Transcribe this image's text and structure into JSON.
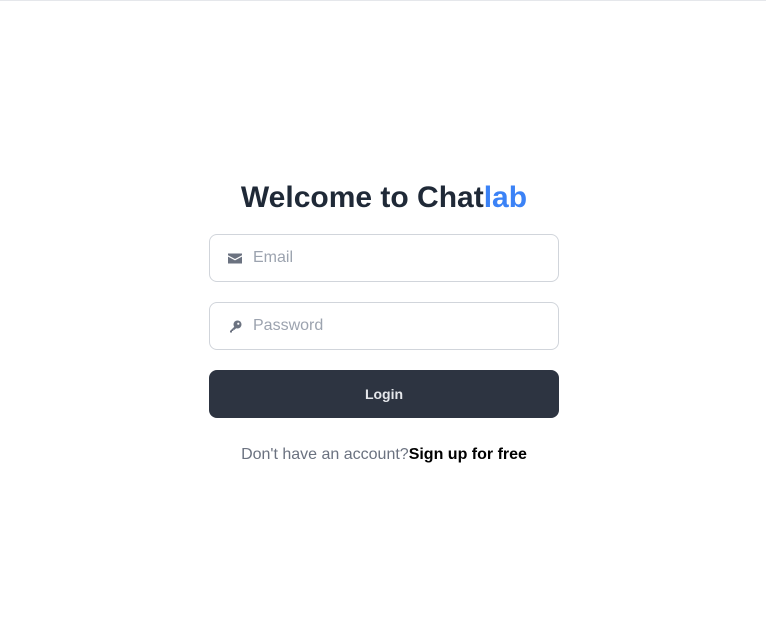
{
  "header": {
    "title_main": "Welcome to Chat",
    "title_accent": "lab"
  },
  "form": {
    "email_placeholder": "Email",
    "email_value": "",
    "password_placeholder": "Password",
    "password_value": "",
    "login_label": "Login"
  },
  "signup": {
    "prompt": "Don't have an account?",
    "link_label": "Sign up for free"
  },
  "icons": {
    "email": "envelope-icon",
    "password": "key-icon"
  },
  "colors": {
    "accent": "#3b82f6",
    "heading": "#1f2937",
    "button_bg": "#2d3441",
    "muted": "#6b7280"
  }
}
